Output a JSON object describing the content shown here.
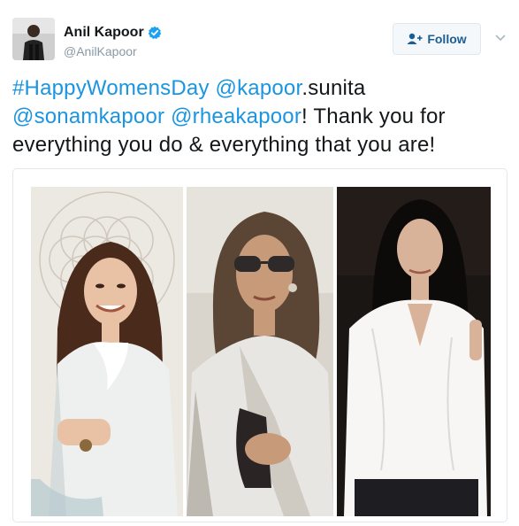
{
  "user": {
    "display_name": "Anil Kapoor",
    "handle": "@AnilKapoor",
    "verified": true
  },
  "follow_button": {
    "label": "Follow",
    "icon": "add-user-icon"
  },
  "menu": {
    "icon": "chevron-down-icon"
  },
  "tweet": {
    "hashtag": "#HappyWomensDay",
    "mention1": "@kapoor",
    "mention1_tail": ".sunita",
    "mention2": "@sonamkapoor",
    "mention3": "@rheakapoor",
    "body": "! Thank you for everything you do & everything that you are!"
  },
  "media": {
    "panels": [
      "photo-woman-long-wavy-hair",
      "photo-woman-sunglasses",
      "photo-woman-white-shirt"
    ]
  },
  "colors": {
    "link": "#1b95e0",
    "text": "#14171a",
    "muted": "#8899a6",
    "verified": "#1da1f2",
    "follow_text": "#1b5e94"
  }
}
